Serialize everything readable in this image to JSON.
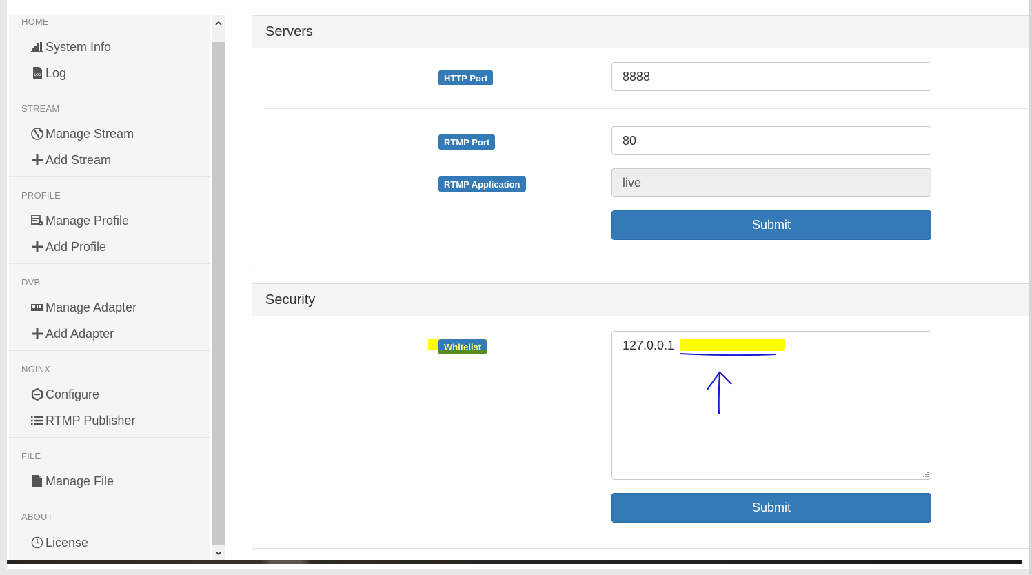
{
  "sidebar": {
    "sections": [
      {
        "title": "HOME",
        "items": [
          {
            "label": "System Info",
            "icon": "bar-chart-icon"
          },
          {
            "label": "Log",
            "icon": "log-file-icon"
          }
        ]
      },
      {
        "title": "STREAM",
        "items": [
          {
            "label": "Manage Stream",
            "icon": "globe-icon"
          },
          {
            "label": "Add Stream",
            "icon": "plus-icon"
          }
        ]
      },
      {
        "title": "PROFILE",
        "items": [
          {
            "label": "Manage Profile",
            "icon": "profile-settings-icon"
          },
          {
            "label": "Add Profile",
            "icon": "plus-icon"
          }
        ]
      },
      {
        "title": "DVB",
        "items": [
          {
            "label": "Manage Adapter",
            "icon": "adapter-card-icon"
          },
          {
            "label": "Add Adapter",
            "icon": "plus-icon"
          }
        ]
      },
      {
        "title": "NGINX",
        "items": [
          {
            "label": "Configure",
            "icon": "nginx-icon"
          },
          {
            "label": "RTMP Publisher",
            "icon": "list-icon"
          }
        ]
      },
      {
        "title": "FILE",
        "items": [
          {
            "label": "Manage File",
            "icon": "file-icon"
          }
        ]
      },
      {
        "title": "ABOUT",
        "items": [
          {
            "label": "License",
            "icon": "clock-icon"
          }
        ]
      }
    ]
  },
  "servers": {
    "title": "Servers",
    "http_port_label": "HTTP Port",
    "http_port_value": "8888",
    "rtmp_port_label": "RTMP Port",
    "rtmp_port_value": "80",
    "rtmp_app_label": "RTMP Application",
    "rtmp_app_value": "live",
    "submit_label": "Submit"
  },
  "security": {
    "title": "Security",
    "whitelist_label": "Whitelist",
    "whitelist_value": "127.0.0.1",
    "submit_label": "Submit"
  },
  "colors": {
    "primary": "#337ab7",
    "highlight": "#ffff00",
    "annotation": "#1a1ad0"
  }
}
